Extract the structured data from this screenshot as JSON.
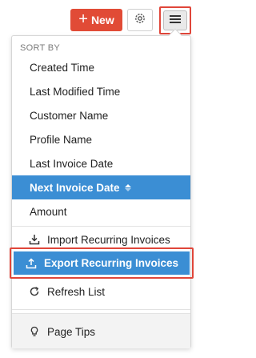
{
  "toolbar": {
    "new_label": "New",
    "new_icon": "plus-icon",
    "gear_icon": "gear-icon",
    "menu_icon": "hamburger-icon",
    "accent_color": "#e14b36"
  },
  "dropdown": {
    "section_title": "SORT BY",
    "sort_items": [
      {
        "label": "Created Time"
      },
      {
        "label": "Last Modified Time"
      },
      {
        "label": "Customer Name"
      },
      {
        "label": "Profile Name"
      },
      {
        "label": "Last Invoice Date"
      },
      {
        "label": "Next Invoice Date",
        "active": true
      },
      {
        "label": "Amount"
      }
    ],
    "actions": {
      "import_label": "Import Recurring Invoices",
      "export_label": "Export Recurring Invoices",
      "refresh_label": "Refresh List",
      "tips_label": "Page Tips"
    },
    "active_color": "#3b8ed4"
  }
}
